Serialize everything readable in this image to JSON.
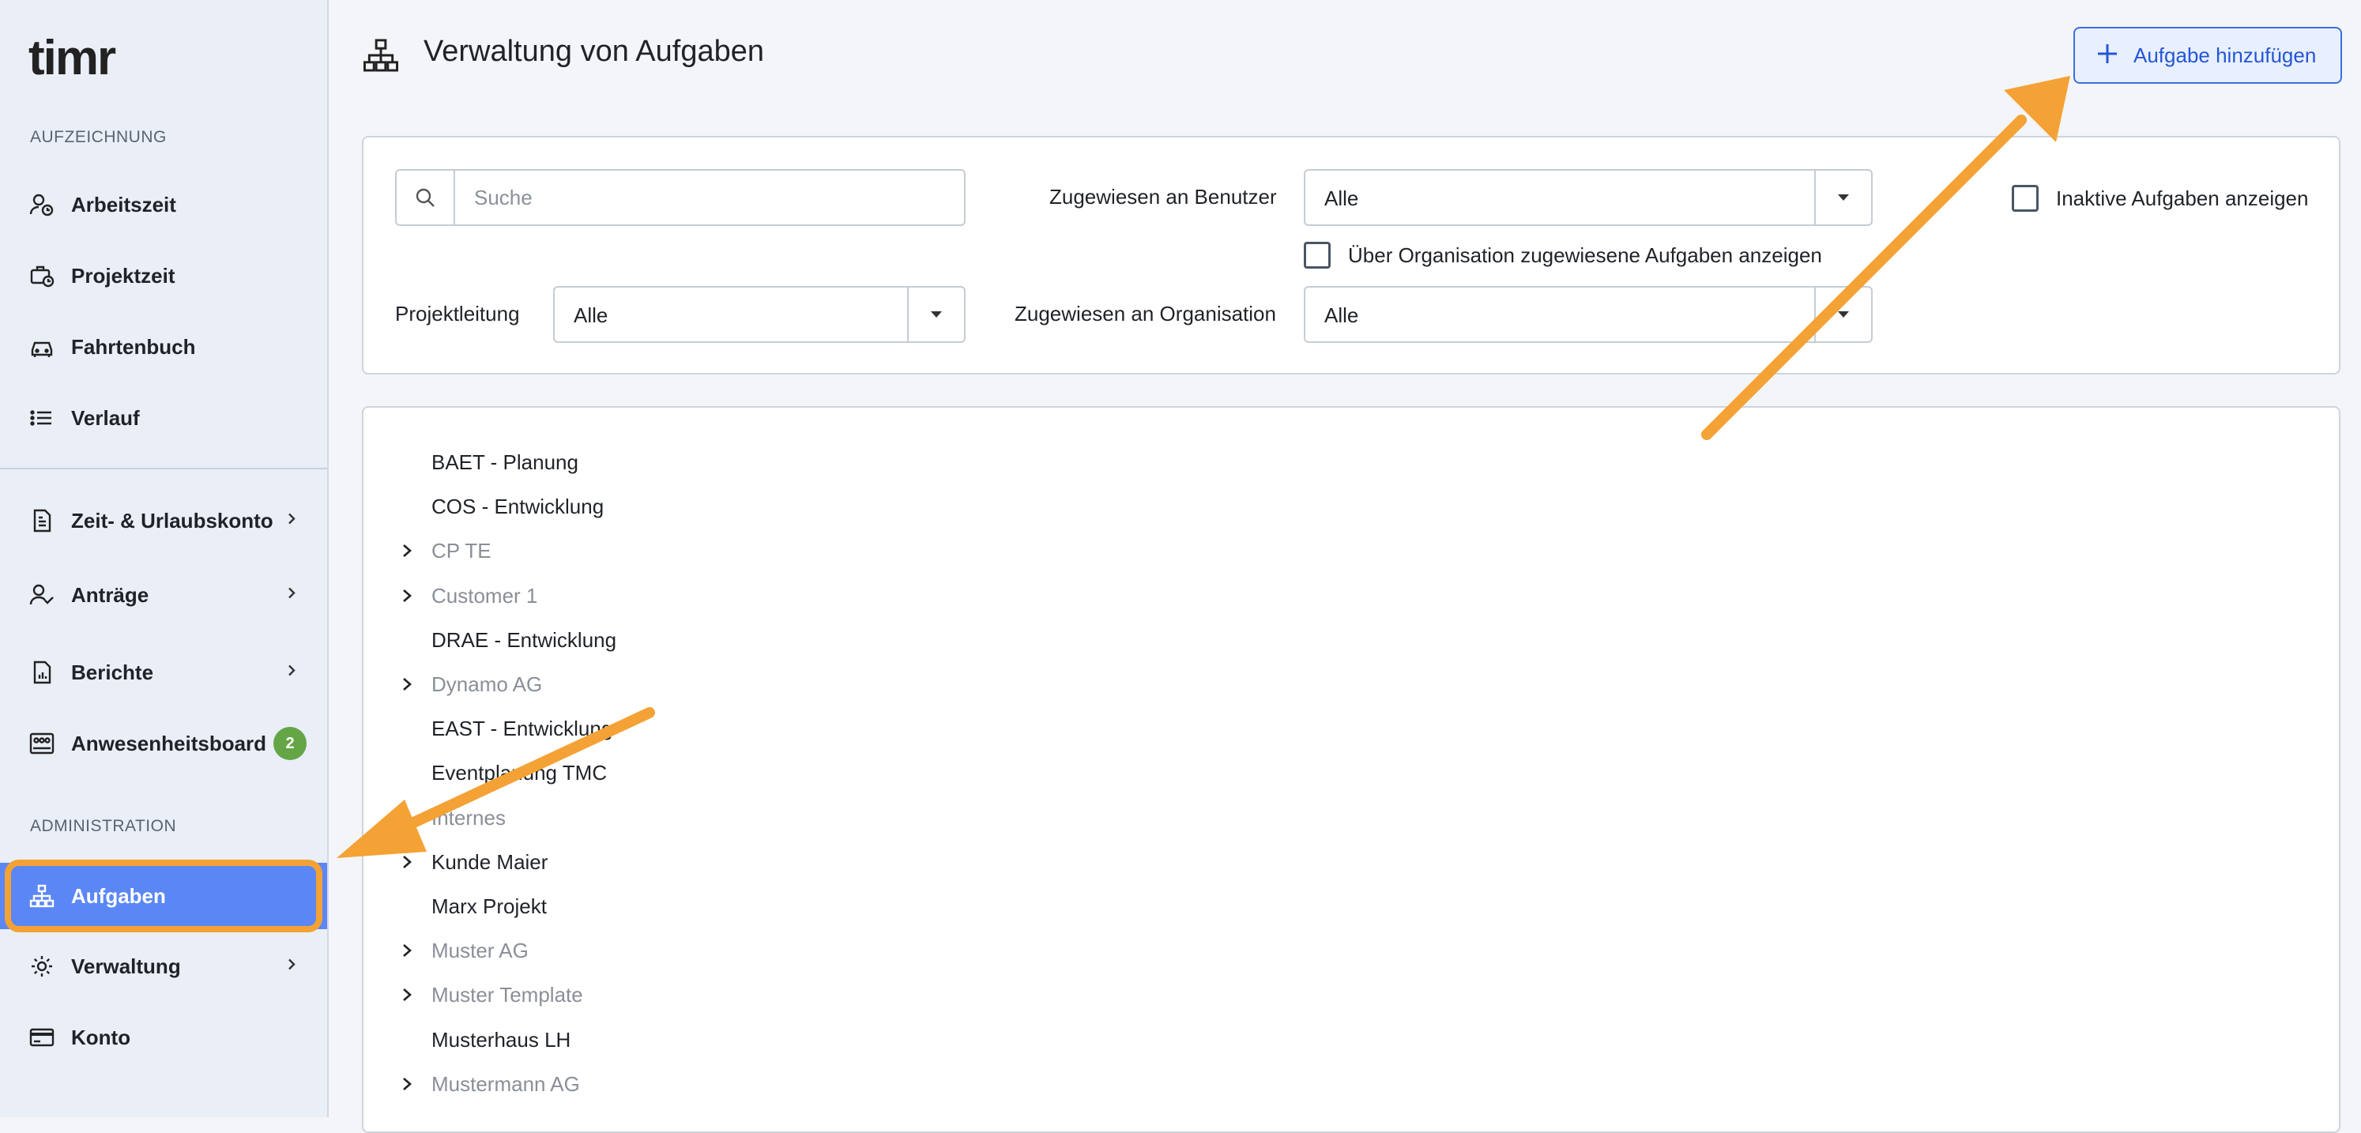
{
  "app": {
    "logo_text": "timr"
  },
  "sidebar": {
    "section_recording": "AUFZEICHNUNG",
    "section_admin": "ADMINISTRATION",
    "items": [
      {
        "label": "Arbeitszeit",
        "icon": "user-clock-icon"
      },
      {
        "label": "Projektzeit",
        "icon": "briefcase-clock-icon"
      },
      {
        "label": "Fahrtenbuch",
        "icon": "car-icon"
      },
      {
        "label": "Verlauf",
        "icon": "list-icon"
      },
      {
        "label": "Zeit- & Urlaubskonto",
        "icon": "document-account-icon"
      },
      {
        "label": "Anträge",
        "icon": "user-check-icon"
      },
      {
        "label": "Berichte",
        "icon": "report-icon"
      },
      {
        "label": "Anwesenheitsboard",
        "icon": "presence-board-icon",
        "badge": "2"
      },
      {
        "label": "Aufgaben",
        "icon": "hierarchy-icon",
        "active": true
      },
      {
        "label": "Verwaltung",
        "icon": "gear-icon"
      },
      {
        "label": "Konto",
        "icon": "credit-card-icon"
      }
    ]
  },
  "header": {
    "title": "Verwaltung von Aufgaben",
    "add_button": "Aufgabe hinzufügen"
  },
  "filters": {
    "search_placeholder": "Suche",
    "assigned_user_label": "Zugewiesen an Benutzer",
    "assigned_user_value": "Alle",
    "project_lead_label": "Projektleitung",
    "project_lead_value": "Alle",
    "assigned_org_label": "Zugewiesen an Organisation",
    "assigned_org_value": "Alle",
    "show_org_tasks_label": "Über Organisation zugewiesene Aufgaben anzeigen",
    "show_inactive_label": "Inaktive Aufgaben anzeigen"
  },
  "tasks": [
    {
      "name": "BAET - Planung",
      "expandable": false,
      "muted": false
    },
    {
      "name": "COS - Entwicklung",
      "expandable": false,
      "muted": false
    },
    {
      "name": "CP TE",
      "expandable": true,
      "muted": true
    },
    {
      "name": "Customer 1",
      "expandable": true,
      "muted": true
    },
    {
      "name": "DRAE - Entwicklung",
      "expandable": false,
      "muted": false
    },
    {
      "name": "Dynamo AG",
      "expandable": true,
      "muted": true
    },
    {
      "name": "EAST - Entwicklung",
      "expandable": false,
      "muted": false
    },
    {
      "name": "Eventplanung TMC",
      "expandable": false,
      "muted": false
    },
    {
      "name": "Internes",
      "expandable": true,
      "muted": true
    },
    {
      "name": "Kunde Maier",
      "expandable": true,
      "muted": false
    },
    {
      "name": "Marx Projekt",
      "expandable": false,
      "muted": false
    },
    {
      "name": "Muster AG",
      "expandable": true,
      "muted": true
    },
    {
      "name": "Muster Template",
      "expandable": true,
      "muted": true
    },
    {
      "name": "Musterhaus LH",
      "expandable": false,
      "muted": false
    },
    {
      "name": "Mustermann AG",
      "expandable": true,
      "muted": true
    }
  ],
  "colors": {
    "accent": "#5b87f5",
    "annotation_orange": "#f4a235",
    "badge_green": "#64a646",
    "add_button_text": "#2456d6"
  }
}
